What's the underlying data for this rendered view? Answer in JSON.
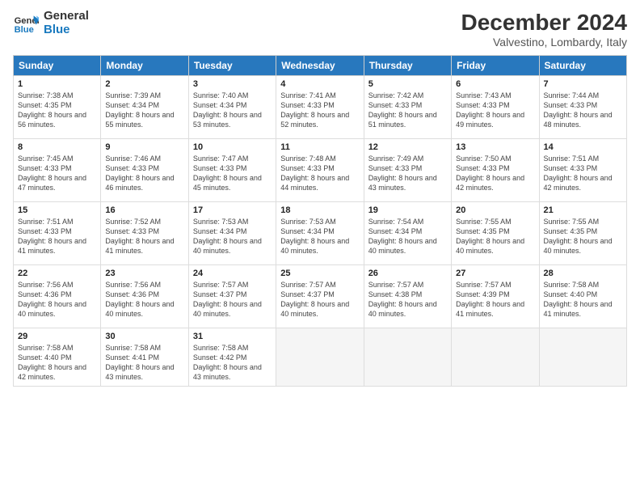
{
  "logo": {
    "line1": "General",
    "line2": "Blue"
  },
  "title": "December 2024",
  "subtitle": "Valvestino, Lombardy, Italy",
  "weekdays": [
    "Sunday",
    "Monday",
    "Tuesday",
    "Wednesday",
    "Thursday",
    "Friday",
    "Saturday"
  ],
  "weeks": [
    [
      {
        "day": "1",
        "sunrise": "Sunrise: 7:38 AM",
        "sunset": "Sunset: 4:35 PM",
        "daylight": "Daylight: 8 hours and 56 minutes."
      },
      {
        "day": "2",
        "sunrise": "Sunrise: 7:39 AM",
        "sunset": "Sunset: 4:34 PM",
        "daylight": "Daylight: 8 hours and 55 minutes."
      },
      {
        "day": "3",
        "sunrise": "Sunrise: 7:40 AM",
        "sunset": "Sunset: 4:34 PM",
        "daylight": "Daylight: 8 hours and 53 minutes."
      },
      {
        "day": "4",
        "sunrise": "Sunrise: 7:41 AM",
        "sunset": "Sunset: 4:33 PM",
        "daylight": "Daylight: 8 hours and 52 minutes."
      },
      {
        "day": "5",
        "sunrise": "Sunrise: 7:42 AM",
        "sunset": "Sunset: 4:33 PM",
        "daylight": "Daylight: 8 hours and 51 minutes."
      },
      {
        "day": "6",
        "sunrise": "Sunrise: 7:43 AM",
        "sunset": "Sunset: 4:33 PM",
        "daylight": "Daylight: 8 hours and 49 minutes."
      },
      {
        "day": "7",
        "sunrise": "Sunrise: 7:44 AM",
        "sunset": "Sunset: 4:33 PM",
        "daylight": "Daylight: 8 hours and 48 minutes."
      }
    ],
    [
      {
        "day": "8",
        "sunrise": "Sunrise: 7:45 AM",
        "sunset": "Sunset: 4:33 PM",
        "daylight": "Daylight: 8 hours and 47 minutes."
      },
      {
        "day": "9",
        "sunrise": "Sunrise: 7:46 AM",
        "sunset": "Sunset: 4:33 PM",
        "daylight": "Daylight: 8 hours and 46 minutes."
      },
      {
        "day": "10",
        "sunrise": "Sunrise: 7:47 AM",
        "sunset": "Sunset: 4:33 PM",
        "daylight": "Daylight: 8 hours and 45 minutes."
      },
      {
        "day": "11",
        "sunrise": "Sunrise: 7:48 AM",
        "sunset": "Sunset: 4:33 PM",
        "daylight": "Daylight: 8 hours and 44 minutes."
      },
      {
        "day": "12",
        "sunrise": "Sunrise: 7:49 AM",
        "sunset": "Sunset: 4:33 PM",
        "daylight": "Daylight: 8 hours and 43 minutes."
      },
      {
        "day": "13",
        "sunrise": "Sunrise: 7:50 AM",
        "sunset": "Sunset: 4:33 PM",
        "daylight": "Daylight: 8 hours and 42 minutes."
      },
      {
        "day": "14",
        "sunrise": "Sunrise: 7:51 AM",
        "sunset": "Sunset: 4:33 PM",
        "daylight": "Daylight: 8 hours and 42 minutes."
      }
    ],
    [
      {
        "day": "15",
        "sunrise": "Sunrise: 7:51 AM",
        "sunset": "Sunset: 4:33 PM",
        "daylight": "Daylight: 8 hours and 41 minutes."
      },
      {
        "day": "16",
        "sunrise": "Sunrise: 7:52 AM",
        "sunset": "Sunset: 4:33 PM",
        "daylight": "Daylight: 8 hours and 41 minutes."
      },
      {
        "day": "17",
        "sunrise": "Sunrise: 7:53 AM",
        "sunset": "Sunset: 4:34 PM",
        "daylight": "Daylight: 8 hours and 40 minutes."
      },
      {
        "day": "18",
        "sunrise": "Sunrise: 7:53 AM",
        "sunset": "Sunset: 4:34 PM",
        "daylight": "Daylight: 8 hours and 40 minutes."
      },
      {
        "day": "19",
        "sunrise": "Sunrise: 7:54 AM",
        "sunset": "Sunset: 4:34 PM",
        "daylight": "Daylight: 8 hours and 40 minutes."
      },
      {
        "day": "20",
        "sunrise": "Sunrise: 7:55 AM",
        "sunset": "Sunset: 4:35 PM",
        "daylight": "Daylight: 8 hours and 40 minutes."
      },
      {
        "day": "21",
        "sunrise": "Sunrise: 7:55 AM",
        "sunset": "Sunset: 4:35 PM",
        "daylight": "Daylight: 8 hours and 40 minutes."
      }
    ],
    [
      {
        "day": "22",
        "sunrise": "Sunrise: 7:56 AM",
        "sunset": "Sunset: 4:36 PM",
        "daylight": "Daylight: 8 hours and 40 minutes."
      },
      {
        "day": "23",
        "sunrise": "Sunrise: 7:56 AM",
        "sunset": "Sunset: 4:36 PM",
        "daylight": "Daylight: 8 hours and 40 minutes."
      },
      {
        "day": "24",
        "sunrise": "Sunrise: 7:57 AM",
        "sunset": "Sunset: 4:37 PM",
        "daylight": "Daylight: 8 hours and 40 minutes."
      },
      {
        "day": "25",
        "sunrise": "Sunrise: 7:57 AM",
        "sunset": "Sunset: 4:37 PM",
        "daylight": "Daylight: 8 hours and 40 minutes."
      },
      {
        "day": "26",
        "sunrise": "Sunrise: 7:57 AM",
        "sunset": "Sunset: 4:38 PM",
        "daylight": "Daylight: 8 hours and 40 minutes."
      },
      {
        "day": "27",
        "sunrise": "Sunrise: 7:57 AM",
        "sunset": "Sunset: 4:39 PM",
        "daylight": "Daylight: 8 hours and 41 minutes."
      },
      {
        "day": "28",
        "sunrise": "Sunrise: 7:58 AM",
        "sunset": "Sunset: 4:40 PM",
        "daylight": "Daylight: 8 hours and 41 minutes."
      }
    ],
    [
      {
        "day": "29",
        "sunrise": "Sunrise: 7:58 AM",
        "sunset": "Sunset: 4:40 PM",
        "daylight": "Daylight: 8 hours and 42 minutes."
      },
      {
        "day": "30",
        "sunrise": "Sunrise: 7:58 AM",
        "sunset": "Sunset: 4:41 PM",
        "daylight": "Daylight: 8 hours and 43 minutes."
      },
      {
        "day": "31",
        "sunrise": "Sunrise: 7:58 AM",
        "sunset": "Sunset: 4:42 PM",
        "daylight": "Daylight: 8 hours and 43 minutes."
      },
      null,
      null,
      null,
      null
    ]
  ]
}
